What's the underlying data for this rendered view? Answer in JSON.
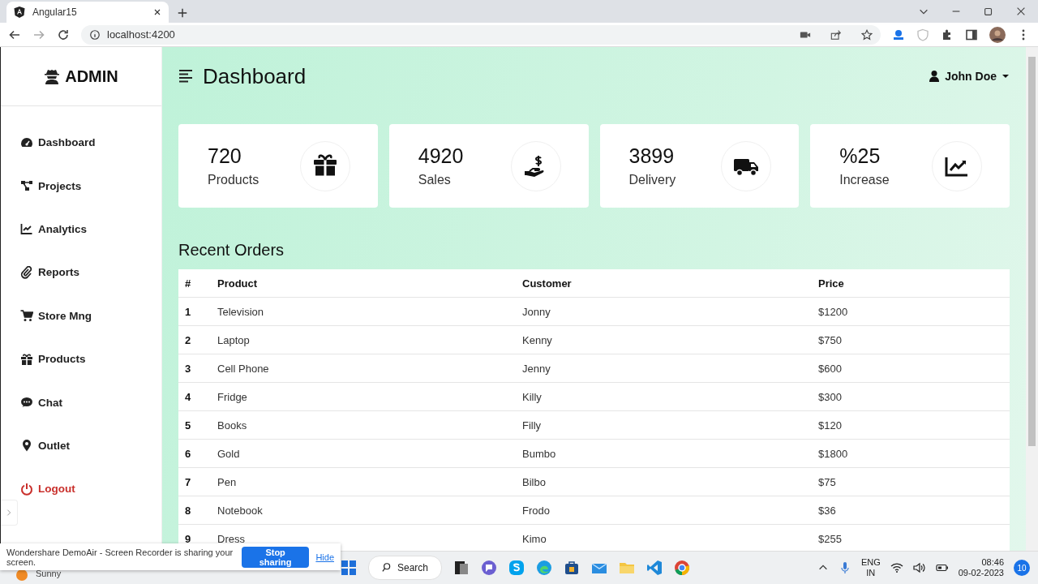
{
  "browser": {
    "tab_title": "Angular15",
    "url": "localhost:4200"
  },
  "sidebar": {
    "brand": "ADMIN",
    "items": [
      {
        "label": "Dashboard",
        "kind": "nav"
      },
      {
        "label": "Projects",
        "kind": "nav"
      },
      {
        "label": "Analytics",
        "kind": "nav"
      },
      {
        "label": "Reports",
        "kind": "nav"
      },
      {
        "label": "Store Mng",
        "kind": "nav"
      },
      {
        "label": "Products",
        "kind": "nav"
      },
      {
        "label": "Chat",
        "kind": "nav"
      },
      {
        "label": "Outlet",
        "kind": "nav"
      },
      {
        "label": "Logout",
        "kind": "logout"
      }
    ]
  },
  "header": {
    "title": "Dashboard",
    "user": "John Doe"
  },
  "stats": [
    {
      "value": "720",
      "label": "Products"
    },
    {
      "value": "4920",
      "label": "Sales"
    },
    {
      "value": "3899",
      "label": "Delivery"
    },
    {
      "value": "%25",
      "label": "Increase"
    }
  ],
  "orders": {
    "title": "Recent Orders",
    "columns": [
      "#",
      "Product",
      "Customer",
      "Price"
    ],
    "rows": [
      [
        "1",
        "Television",
        "Jonny",
        "$1200"
      ],
      [
        "2",
        "Laptop",
        "Kenny",
        "$750"
      ],
      [
        "3",
        "Cell Phone",
        "Jenny",
        "$600"
      ],
      [
        "4",
        "Fridge",
        "Killy",
        "$300"
      ],
      [
        "5",
        "Books",
        "Filly",
        "$120"
      ],
      [
        "6",
        "Gold",
        "Bumbo",
        "$1800"
      ],
      [
        "7",
        "Pen",
        "Bilbo",
        "$75"
      ],
      [
        "8",
        "Notebook",
        "Frodo",
        "$36"
      ],
      [
        "9",
        "Dress",
        "Kimo",
        "$255"
      ]
    ]
  },
  "share_bar": {
    "message": "Wondershare DemoAir - Screen Recorder is sharing your screen.",
    "stop_button": "Stop sharing",
    "hide_link": "Hide"
  },
  "taskbar": {
    "weather": "Sunny",
    "search": "Search",
    "language": "ENG",
    "region": "IN",
    "time": "08:46",
    "date": "09-02-2023",
    "notifications": "10"
  }
}
